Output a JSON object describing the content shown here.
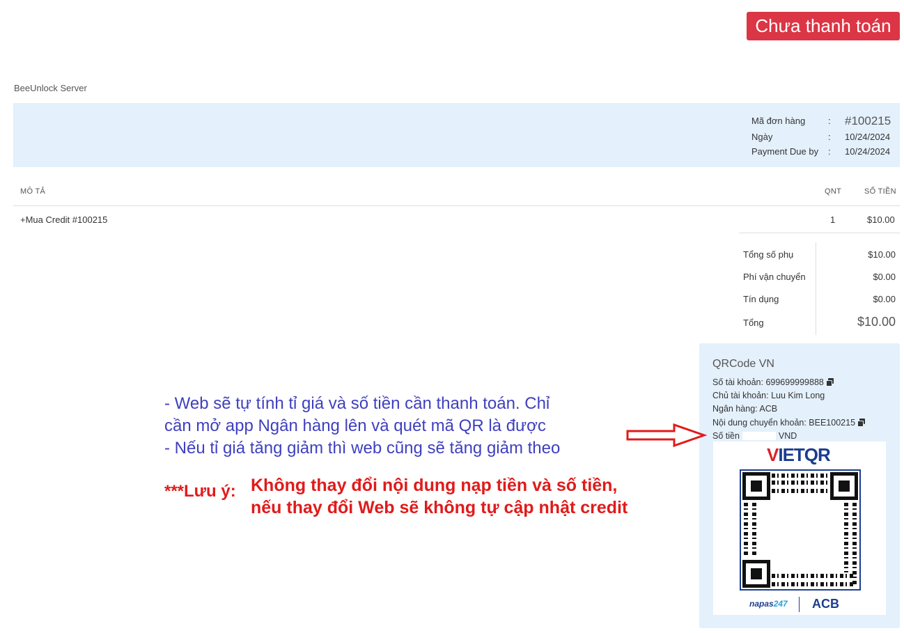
{
  "status_badge": "Chưa thanh toán",
  "company": "BeeUnlock Server",
  "invoice": {
    "rows": [
      {
        "label": "Mã đơn hàng",
        "sep": ":",
        "value": "#100215"
      },
      {
        "label": "Ngày",
        "sep": ":",
        "value": "10/24/2024"
      },
      {
        "label": "Payment Due by",
        "sep": ":",
        "value": "10/24/2024"
      }
    ]
  },
  "table": {
    "col_desc": "MÔ TẢ",
    "col_qty": "QNT",
    "col_amount": "SỐ TIỀN",
    "item_desc": "+Mua Credit #100215",
    "item_qty": "1",
    "item_amount": "$10.00"
  },
  "totals": {
    "subtotal_label": "Tổng số phụ",
    "subtotal_value": "$10.00",
    "shipping_label": "Phí vận chuyển",
    "shipping_value": "$0.00",
    "credit_label": "Tín dụng",
    "credit_value": "$0.00",
    "total_label": "Tổng",
    "total_value": "$10.00"
  },
  "qr_panel": {
    "title": "QRCode VN",
    "account_number": "Số tài khoản: 699699999888",
    "account_holder": "Chủ tài khoản: Luu Kim Long",
    "bank": "Ngân hàng: ACB",
    "transfer_content": "Nội dung chuyển khoản: BEE100215",
    "amount_label": "Số tiền",
    "amount_currency": "VND",
    "vietqr_v": "V",
    "vietqr_rest": "IETQR",
    "napas_a": "napas",
    "napas_b": "247",
    "acb_logo": "ACB"
  },
  "notes": {
    "blue_line1": "- Web sẽ tự tính tỉ giá và số tiền cần thanh toán. Chỉ",
    "blue_line2": "cần mở app Ngân hàng lên và quét mã QR là được",
    "blue_line3": "- Nếu tỉ giá tăng giảm thì web cũng sẽ tăng giảm theo",
    "warning_prefix": "***Lưu ý:",
    "warning_line1": "Không thay đổi nội dung nạp tiền và số tiền,",
    "warning_line2": "nếu thay đổi Web sẽ không tự cập nhật credit"
  },
  "colors": {
    "badge": "#dc3545",
    "panel": "#e4f0fb",
    "note_blue": "#3f3fbf",
    "note_red": "#e01b1b",
    "brand_blue": "#1b3d8f"
  }
}
